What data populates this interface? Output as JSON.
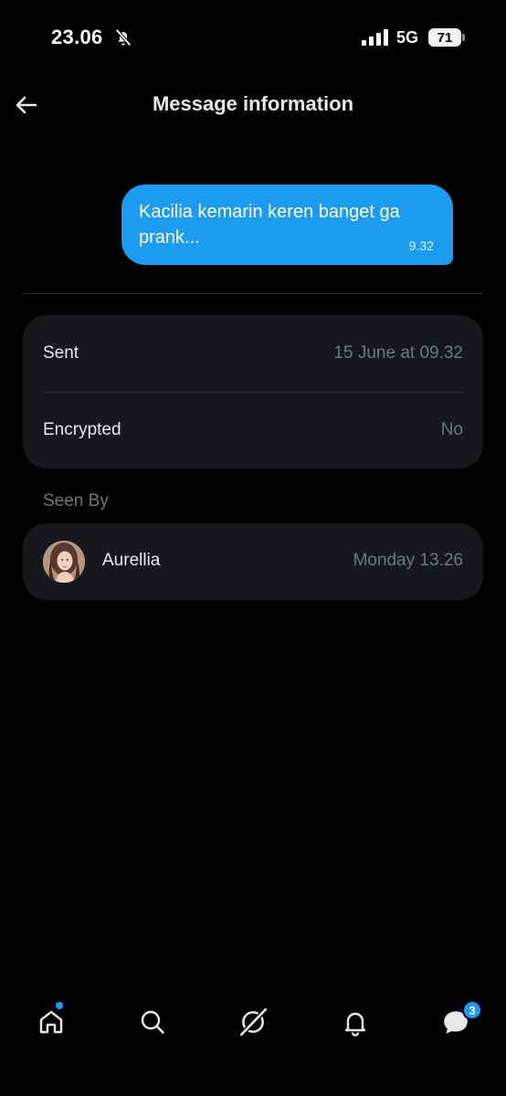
{
  "status_bar": {
    "time": "23.06",
    "network": "5G",
    "battery": "71"
  },
  "header": {
    "title": "Message information"
  },
  "message": {
    "text": "Kacilia kemarin keren banget ga prank...",
    "time": "9.32",
    "bubble_color": "#1d9bf0"
  },
  "info": {
    "rows": [
      {
        "label": "Sent",
        "value": "15 June at 09.32"
      },
      {
        "label": "Encrypted",
        "value": "No"
      }
    ]
  },
  "seen_by": {
    "heading": "Seen By",
    "entries": [
      {
        "name": "Aurellia",
        "time": "Monday 13.26"
      }
    ]
  },
  "bottom_nav": {
    "items": [
      {
        "icon": "home-icon",
        "has_dot": true
      },
      {
        "icon": "search-icon"
      },
      {
        "icon": "grok-icon"
      },
      {
        "icon": "bell-icon"
      },
      {
        "icon": "messages-icon",
        "badge": "3"
      }
    ]
  },
  "colors": {
    "background": "#000000",
    "card": "#16181c",
    "accent": "#1d9bf0",
    "secondary_text": "#71767b"
  }
}
